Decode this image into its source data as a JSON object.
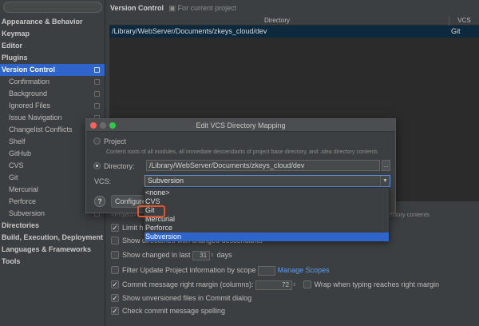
{
  "sidebar": {
    "items": [
      {
        "label": "Appearance & Behavior",
        "level": "top"
      },
      {
        "label": "Keymap",
        "level": "top"
      },
      {
        "label": "Editor",
        "level": "top"
      },
      {
        "label": "Plugins",
        "level": "top"
      },
      {
        "label": "Version Control",
        "level": "top",
        "selected": true
      },
      {
        "label": "Confirmation",
        "level": "sub"
      },
      {
        "label": "Background",
        "level": "sub"
      },
      {
        "label": "Ignored Files",
        "level": "sub"
      },
      {
        "label": "Issue Navigation",
        "level": "sub"
      },
      {
        "label": "Changelist Conflicts",
        "level": "sub"
      },
      {
        "label": "Shelf",
        "level": "sub"
      },
      {
        "label": "GitHub",
        "level": "sub"
      },
      {
        "label": "CVS",
        "level": "sub"
      },
      {
        "label": "Git",
        "level": "sub"
      },
      {
        "label": "Mercurial",
        "level": "sub"
      },
      {
        "label": "Perforce",
        "level": "sub"
      },
      {
        "label": "Subversion",
        "level": "sub"
      },
      {
        "label": "Directories",
        "level": "top"
      },
      {
        "label": "Build, Execution, Deployment",
        "level": "top"
      },
      {
        "label": "Languages & Frameworks",
        "level": "top"
      },
      {
        "label": "Tools",
        "level": "top"
      }
    ]
  },
  "main": {
    "title": "Version Control",
    "subtitle": "For current project",
    "table": {
      "columns": [
        "Directory",
        "VCS"
      ],
      "rows": [
        [
          "/Library/WebServer/Documents/zkeys_cloud/dev",
          "Git"
        ]
      ]
    },
    "project_hint_left": "<Project>",
    "project_hint_right": "irectory contents",
    "options": {
      "limit_history": "Limit hi",
      "show_dirs": "Show directories with changed descendants",
      "show_changed_prefix": "Show changed in last",
      "show_changed_value": "31",
      "show_changed_suffix": "days",
      "filter_update": "Filter Update Project information by scope",
      "manage_scopes": "Manage Scopes",
      "commit_margin": "Commit message right margin (columns):",
      "commit_margin_value": "72",
      "wrap_typing": "Wrap when typing reaches right margin",
      "show_unversioned": "Show unversioned files in Commit dialog",
      "check_spelling": "Check commit message spelling"
    }
  },
  "dialog": {
    "title": "Edit VCS Directory Mapping",
    "project_label": "Project",
    "project_desc": "Content roots of all modules, all immediate descendants of project base directory, and .idea directory contents",
    "directory_label": "Directory:",
    "directory_value": "/Library/WebServer/Documents/zkeys_cloud/dev",
    "browse_label": "...",
    "vcs_label": "VCS:",
    "vcs_value": "Subversion",
    "help_label": "?",
    "configure_label": "Configure"
  },
  "dropdown": {
    "options": [
      "<none>",
      "CVS",
      "Git",
      "Mercurial",
      "Perforce",
      "Subversion"
    ],
    "highlighted": "Subversion"
  },
  "colors": {
    "selection": "#2f65ca",
    "callout": "#e2542d",
    "link": "#589df6"
  }
}
